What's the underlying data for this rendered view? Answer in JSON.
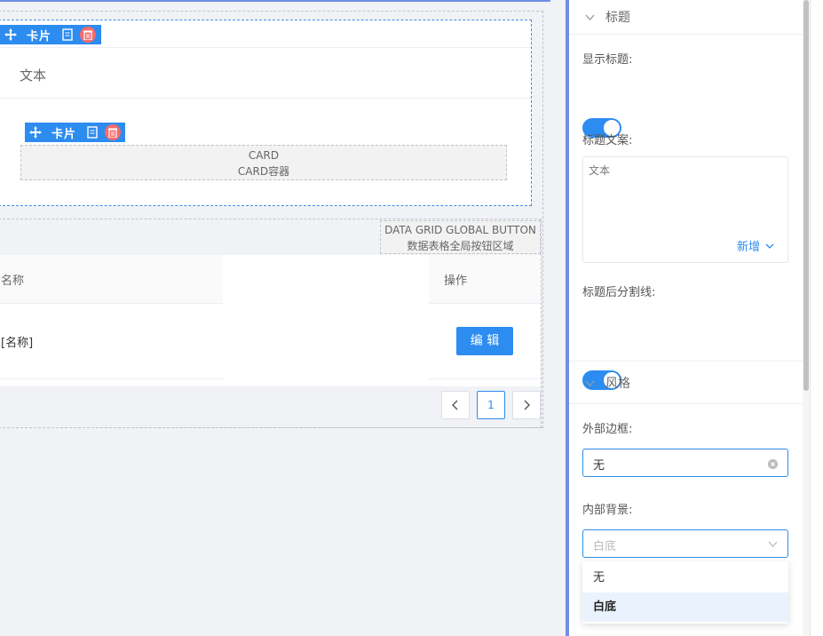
{
  "card_toolbar_label": "卡片",
  "outer_card": {
    "title": "文本"
  },
  "inner_card": {
    "placeholder_en": "CARD",
    "placeholder_zh": "CARD容器"
  },
  "grid": {
    "global_button_en": "DATA GRID GLOBAL BUTTON",
    "global_button_zh": "数据表格全局按钮区域",
    "columns": [
      "名称",
      "操作"
    ],
    "row_name": "[名称]",
    "edit_label": "编 辑",
    "page": "1"
  },
  "panel": {
    "title_section": "标题",
    "show_title_label": "显示标题:",
    "title_text_label": "标题文案:",
    "title_text_value": "文本",
    "add_new_label": "新增",
    "divider_label": "标题后分割线:",
    "style_section": "风格",
    "outer_border_label": "外部边框:",
    "outer_border_value": "无",
    "inner_bg_label": "内部背景:",
    "inner_bg_value": "白底",
    "dropdown_options": [
      "无",
      "白底"
    ]
  },
  "colors": {
    "accent": "#2d8cf0",
    "danger": "#f56c6c",
    "panel_border": "#6f8fe8"
  }
}
